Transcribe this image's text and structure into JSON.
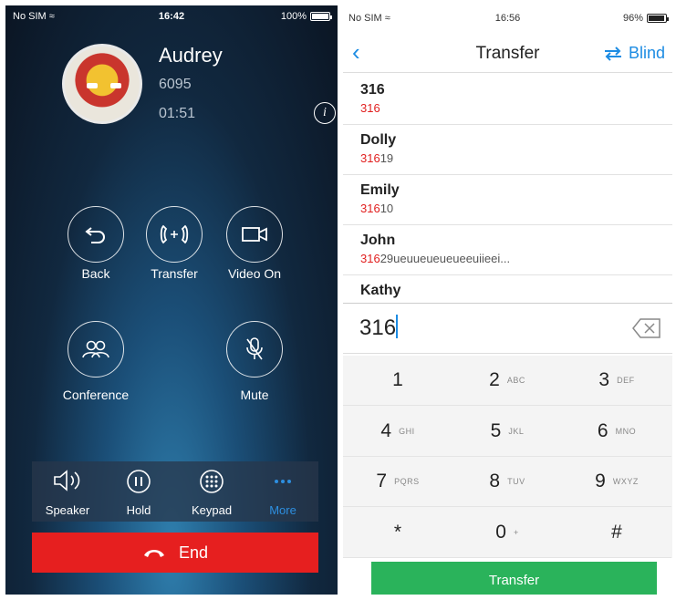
{
  "left": {
    "status": {
      "carrier": "No SIM",
      "time": "16:42",
      "battery": "100%",
      "battery_level": 1.0
    },
    "caller": {
      "name": "Audrey",
      "number": "6095",
      "duration": "01:51"
    },
    "actions": [
      {
        "label": "Back",
        "icon": "back-icon"
      },
      {
        "label": "Transfer",
        "icon": "transfer-icon"
      },
      {
        "label": "Video On",
        "icon": "video-icon"
      },
      {
        "label": "Conference",
        "icon": "conference-icon"
      },
      {
        "label": "Mute",
        "icon": "mute-icon"
      }
    ],
    "toolbar": [
      {
        "label": "Speaker",
        "icon": "speaker-icon"
      },
      {
        "label": "Hold",
        "icon": "hold-icon"
      },
      {
        "label": "Keypad",
        "icon": "keypad-icon"
      },
      {
        "label": "More",
        "icon": "more-icon",
        "active": true
      }
    ],
    "end_label": "End",
    "colors": {
      "end": "#e61f1f",
      "accent": "#2d8fe0"
    }
  },
  "right": {
    "status": {
      "carrier": "No SIM",
      "time": "16:56",
      "battery": "96%",
      "battery_level": 0.96
    },
    "nav": {
      "back": "‹",
      "title": "Transfer",
      "blind": "Blind"
    },
    "contacts": [
      {
        "name": "316",
        "number_match": "316",
        "number_rest": ""
      },
      {
        "name": "Dolly",
        "number_match": "316",
        "number_rest": "19"
      },
      {
        "name": "Emily",
        "number_match": "316",
        "number_rest": "10"
      },
      {
        "name": "John",
        "number_match": "316",
        "number_rest": "29ueuueueueueeuiieei..."
      },
      {
        "name": "Kathy",
        "number_match": "",
        "number_rest": ""
      }
    ],
    "dial_value": "316",
    "keys": [
      {
        "num": "1",
        "letters": ""
      },
      {
        "num": "2",
        "letters": "ABC"
      },
      {
        "num": "3",
        "letters": "DEF"
      },
      {
        "num": "4",
        "letters": "GHI"
      },
      {
        "num": "5",
        "letters": "JKL"
      },
      {
        "num": "6",
        "letters": "MNO"
      },
      {
        "num": "7",
        "letters": "PQRS"
      },
      {
        "num": "8",
        "letters": "TUV"
      },
      {
        "num": "9",
        "letters": "WXYZ"
      },
      {
        "num": "*",
        "letters": ""
      },
      {
        "num": "0",
        "letters": "+"
      },
      {
        "num": "#",
        "letters": ""
      }
    ],
    "transfer_label": "Transfer",
    "colors": {
      "accent": "#1d8ce3",
      "match": "#e12020",
      "transfer": "#2ab35b"
    }
  }
}
